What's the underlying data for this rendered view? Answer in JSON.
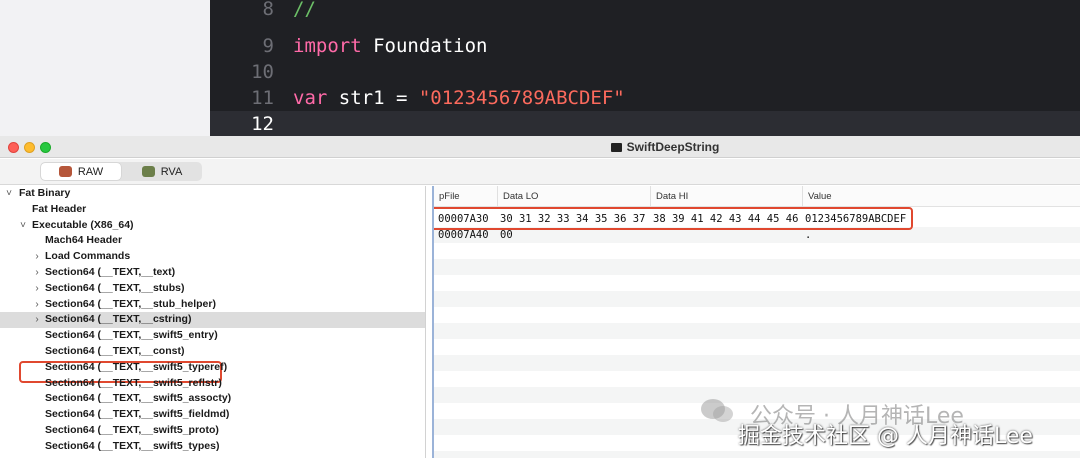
{
  "editor": {
    "lines": [
      {
        "num": "8",
        "tokens": [
          {
            "t": "//",
            "c": "cm"
          }
        ]
      },
      {
        "num": "9",
        "tokens": [
          {
            "t": "import",
            "c": "kw"
          },
          {
            "t": " Foundation",
            "c": ""
          }
        ]
      },
      {
        "num": "10",
        "tokens": []
      },
      {
        "num": "11",
        "tokens": [
          {
            "t": "var",
            "c": "kw"
          },
          {
            "t": " str1 = ",
            "c": ""
          },
          {
            "t": "\"0123456789ABCDEF\"",
            "c": "str"
          }
        ]
      },
      {
        "num": "12",
        "tokens": [],
        "current": true
      }
    ]
  },
  "window": {
    "title": "SwiftDeepString",
    "segments": [
      {
        "label": "RAW",
        "active": true
      },
      {
        "label": "RVA",
        "active": false
      }
    ]
  },
  "tree": [
    {
      "label": "Fat Binary",
      "indent": 0,
      "disclosure": "open"
    },
    {
      "label": "Fat Header",
      "indent": 1,
      "disclosure": ""
    },
    {
      "label": "Executable  (X86_64)",
      "indent": 1,
      "disclosure": "open"
    },
    {
      "label": "Mach64 Header",
      "indent": 2,
      "disclosure": ""
    },
    {
      "label": "Load Commands",
      "indent": 2,
      "disclosure": "closed"
    },
    {
      "label": "Section64 (__TEXT,__text)",
      "indent": 2,
      "disclosure": "closed"
    },
    {
      "label": "Section64 (__TEXT,__stubs)",
      "indent": 2,
      "disclosure": "closed"
    },
    {
      "label": "Section64 (__TEXT,__stub_helper)",
      "indent": 2,
      "disclosure": "closed"
    },
    {
      "label": "Section64 (__TEXT,__cstring)",
      "indent": 2,
      "disclosure": "closed",
      "selected": true
    },
    {
      "label": "Section64 (__TEXT,__swift5_entry)",
      "indent": 2,
      "disclosure": ""
    },
    {
      "label": "Section64 (__TEXT,__const)",
      "indent": 2,
      "disclosure": ""
    },
    {
      "label": "Section64 (__TEXT,__swift5_typeref)",
      "indent": 2,
      "disclosure": ""
    },
    {
      "label": "Section64 (__TEXT,__swift5_reflstr)",
      "indent": 2,
      "disclosure": ""
    },
    {
      "label": "Section64 (__TEXT,__swift5_assocty)",
      "indent": 2,
      "disclosure": ""
    },
    {
      "label": "Section64 (__TEXT,__swift5_fieldmd)",
      "indent": 2,
      "disclosure": ""
    },
    {
      "label": "Section64 (__TEXT,__swift5_proto)",
      "indent": 2,
      "disclosure": ""
    },
    {
      "label": "Section64 (__TEXT,__swift5_types)",
      "indent": 2,
      "disclosure": ""
    }
  ],
  "table": {
    "columns": [
      "pFile",
      "Data LO",
      "Data HI",
      "Value"
    ],
    "rows": [
      [
        "00007A30",
        "30 31 32 33 34 35 36 37",
        "38 39 41 42 43 44 45 46",
        "0123456789ABCDEF"
      ],
      [
        "00007A40",
        "00",
        "",
        "."
      ]
    ]
  },
  "watermark": {
    "line1": "公众号 · 人月神话Lee",
    "line2": "掘金技术社区 @ 人月神话Lee"
  }
}
